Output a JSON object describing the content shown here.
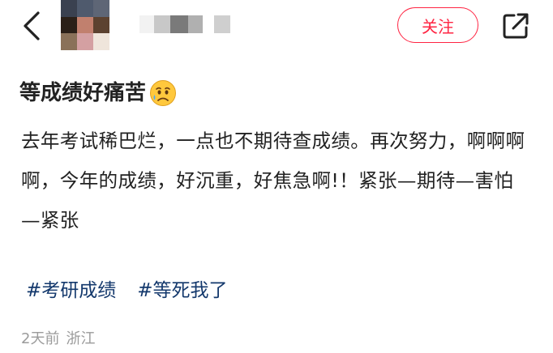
{
  "header": {
    "follow_label": "关注",
    "icons": {
      "back": "chevron-left-icon",
      "share": "share-icon"
    },
    "avatar_colors": [
      "#3a4150",
      "#4f5a6d",
      "#5e6676",
      "#2b2018",
      "#c1806e",
      "#5c4230",
      "#8a7159",
      "#d4a0a2",
      "#efe5db"
    ],
    "username_colors": [
      "#f2f2f2",
      "#c8c8c8",
      "#7a7a7a",
      "#b0b0b0",
      "#ffffff",
      "#cfcfcf"
    ],
    "accent_color": "#ff2442"
  },
  "post": {
    "title": "等成绩好痛苦",
    "title_emoji": "sad-but-relieved-face-emoji",
    "body": "去年考试稀巴烂，一点也不期待查成绩。再次努力，啊啊啊啊，今年的成绩，好沉重，好焦急啊!！紧张—期待—害怕—紧张",
    "tags": [
      "#考研成绩",
      "#等死我了"
    ],
    "tag_color": "#13386c",
    "time": "2天前",
    "location": "浙江"
  }
}
